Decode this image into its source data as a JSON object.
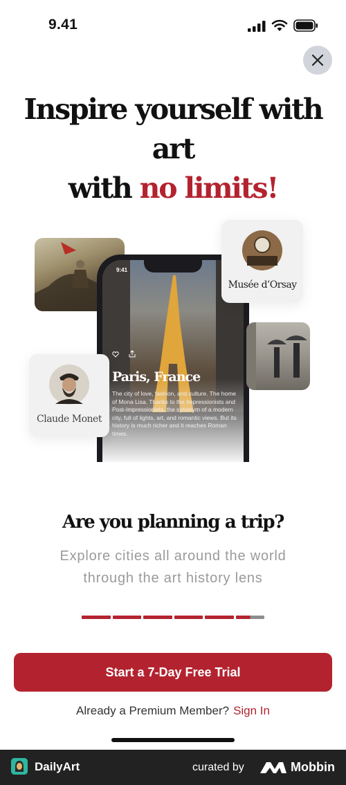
{
  "status": {
    "time": "9.41"
  },
  "heading": {
    "line1": "Inspire yourself with art",
    "line2_plain": "with ",
    "line2_accent": "no limits!"
  },
  "phone_screen": {
    "time": "9:41",
    "city": "Paris, France",
    "description": "The city of love, fashion, and culture. The home of Mona Lisa. Thanks to the Impressionists and Post-Impressionists, the synonym of a modern city, full of lights, art, and romantic views. But its history is much richer and it reaches Roman times."
  },
  "cards": {
    "museum": "Musée d’Orsay",
    "artist": "Claude Monet"
  },
  "subtitle": "Are you planning a trip?",
  "description": "Explore cities all around the world through the art history lens",
  "progress": {
    "steps": 6,
    "current_fraction": 0.92
  },
  "cta": {
    "label": "Start a 7-Day Free Trial"
  },
  "signin": {
    "prompt": "Already a Premium Member?",
    "link": "Sign In"
  },
  "footer": {
    "app_name": "DailyArt",
    "curated_by": "curated by",
    "brand": "Mobbin"
  },
  "colors": {
    "accent": "#b3232f",
    "track": "#8e8e8e",
    "close_bg": "#d1d5db",
    "footer_bg": "#222222"
  },
  "icons": [
    "signal-icon",
    "wifi-icon",
    "battery-icon",
    "close-icon",
    "heart-icon",
    "share-icon"
  ]
}
